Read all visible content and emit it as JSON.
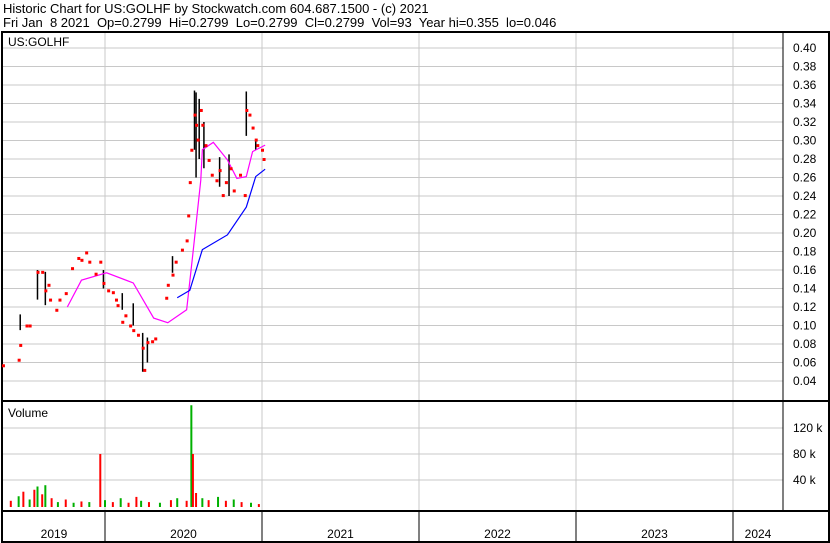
{
  "header": {
    "title": "Historic Chart for US:GOLHF by Stockwatch.com 604.687.1500 - (c) 2021",
    "quote": "Fri Jan  8 2021  Op=0.2799  Hi=0.2799  Lo=0.2799  Cl=0.2799  Vol=93  Year hi=0.355  lo=0.046"
  },
  "chart_data": {
    "type": "line",
    "title": "US:GOLHF",
    "price_ticks": [
      "0.40",
      "0.38",
      "0.36",
      "0.34",
      "0.32",
      "0.30",
      "0.28",
      "0.26",
      "0.24",
      "0.22",
      "0.20",
      "0.18",
      "0.16",
      "0.14",
      "0.12",
      "0.10",
      "0.08",
      "0.06",
      "0.04"
    ],
    "ylim": [
      0.028,
      0.41
    ],
    "year_labels": [
      "2019",
      "2020",
      "2021",
      "2022",
      "2023",
      "2024"
    ],
    "x_range_years": [
      2019.33,
      2024.5
    ],
    "closes": [
      [
        2019.35,
        0.057
      ],
      [
        2019.45,
        0.063
      ],
      [
        2019.46,
        0.079
      ],
      [
        2019.5,
        0.1
      ],
      [
        2019.52,
        0.1
      ],
      [
        2019.57,
        0.158
      ],
      [
        2019.6,
        0.158
      ],
      [
        2019.62,
        0.138
      ],
      [
        2019.64,
        0.144
      ],
      [
        2019.65,
        0.128
      ],
      [
        2019.69,
        0.117
      ],
      [
        2019.71,
        0.128
      ],
      [
        2019.75,
        0.135
      ],
      [
        2019.79,
        0.162
      ],
      [
        2019.83,
        0.173
      ],
      [
        2019.85,
        0.171
      ],
      [
        2019.88,
        0.179
      ],
      [
        2019.9,
        0.169
      ],
      [
        2019.94,
        0.156
      ],
      [
        2019.97,
        0.169
      ],
      [
        2019.99,
        0.146
      ],
      [
        2020.02,
        0.138
      ],
      [
        2020.05,
        0.136
      ],
      [
        2020.07,
        0.128
      ],
      [
        2020.08,
        0.122
      ],
      [
        2020.11,
        0.104
      ],
      [
        2020.13,
        0.111
      ],
      [
        2020.16,
        0.1
      ],
      [
        2020.18,
        0.095
      ],
      [
        2020.21,
        0.09
      ],
      [
        2020.24,
        0.076
      ],
      [
        2020.25,
        0.052
      ],
      [
        2020.27,
        0.082
      ],
      [
        2020.3,
        0.083
      ],
      [
        2020.32,
        0.086
      ],
      [
        2020.39,
        0.13
      ],
      [
        2020.4,
        0.144
      ],
      [
        2020.43,
        0.155
      ],
      [
        2020.45,
        0.169
      ],
      [
        2020.49,
        0.182
      ],
      [
        2020.52,
        0.192
      ],
      [
        2020.53,
        0.219
      ],
      [
        2020.54,
        0.255
      ],
      [
        2020.55,
        0.29
      ],
      [
        2020.57,
        0.328
      ],
      [
        2020.58,
        0.317
      ],
      [
        2020.59,
        0.301
      ],
      [
        2020.61,
        0.333
      ],
      [
        2020.62,
        0.317
      ],
      [
        2020.64,
        0.295
      ],
      [
        2020.66,
        0.279
      ],
      [
        2020.68,
        0.263
      ],
      [
        2020.71,
        0.257
      ],
      [
        2020.73,
        0.268
      ],
      [
        2020.75,
        0.241
      ],
      [
        2020.77,
        0.255
      ],
      [
        2020.8,
        0.27
      ],
      [
        2020.82,
        0.246
      ],
      [
        2020.86,
        0.263
      ],
      [
        2020.89,
        0.241
      ],
      [
        2020.9,
        0.333
      ],
      [
        2020.92,
        0.328
      ],
      [
        2020.94,
        0.314
      ],
      [
        2020.96,
        0.301
      ],
      [
        2020.97,
        0.295
      ],
      [
        2021.0,
        0.29
      ],
      [
        2021.01,
        0.28
      ]
    ],
    "hilo_bars": [
      [
        2019.46,
        0.112,
        0.095
      ],
      [
        2019.57,
        0.16,
        0.128
      ],
      [
        2019.62,
        0.158,
        0.122
      ],
      [
        2019.99,
        0.16,
        0.14
      ],
      [
        2020.11,
        0.135,
        0.117
      ],
      [
        2020.18,
        0.124,
        0.1
      ],
      [
        2020.24,
        0.092,
        0.05
      ],
      [
        2020.27,
        0.087,
        0.06
      ],
      [
        2020.43,
        0.175,
        0.157
      ],
      [
        2020.57,
        0.354,
        0.29
      ],
      [
        2020.58,
        0.352,
        0.26
      ],
      [
        2020.6,
        0.345,
        0.28
      ],
      [
        2020.63,
        0.32,
        0.27
      ],
      [
        2020.73,
        0.282,
        0.25
      ],
      [
        2020.79,
        0.285,
        0.24
      ],
      [
        2020.9,
        0.353,
        0.305
      ],
      [
        2020.96,
        0.3,
        0.29
      ]
    ],
    "series": [
      {
        "name": "short moving average",
        "color": "#ff00ff",
        "points": [
          [
            2019.76,
            0.12
          ],
          [
            2019.85,
            0.149
          ],
          [
            2020.01,
            0.157
          ],
          [
            2020.18,
            0.146
          ],
          [
            2020.31,
            0.108
          ],
          [
            2020.4,
            0.103
          ],
          [
            2020.52,
            0.117
          ],
          [
            2020.56,
            0.178
          ],
          [
            2020.61,
            0.257
          ],
          [
            2020.62,
            0.29
          ],
          [
            2020.69,
            0.298
          ],
          [
            2020.78,
            0.279
          ],
          [
            2020.84,
            0.259
          ],
          [
            2020.9,
            0.261
          ],
          [
            2020.94,
            0.288
          ],
          [
            2021.02,
            0.295
          ]
        ]
      },
      {
        "name": "long moving average",
        "color": "#0000ff",
        "points": [
          [
            2020.46,
            0.13
          ],
          [
            2020.54,
            0.138
          ],
          [
            2020.62,
            0.182
          ],
          [
            2020.78,
            0.198
          ],
          [
            2020.9,
            0.228
          ],
          [
            2020.96,
            0.261
          ],
          [
            2021.02,
            0.269
          ]
        ]
      }
    ],
    "volume": {
      "label": "Volume",
      "ticks": [
        "120 k",
        "80 k",
        "40 k"
      ],
      "tick_values": [
        120000,
        80000,
        40000
      ],
      "ylim": [
        0,
        160000
      ],
      "bars": [
        [
          2019.4,
          8000,
          "r"
        ],
        [
          2019.45,
          15000,
          "g"
        ],
        [
          2019.48,
          22000,
          "r"
        ],
        [
          2019.52,
          10000,
          "g"
        ],
        [
          2019.55,
          25000,
          "r"
        ],
        [
          2019.57,
          30000,
          "g"
        ],
        [
          2019.6,
          18000,
          "r"
        ],
        [
          2019.62,
          32000,
          "g"
        ],
        [
          2019.66,
          12000,
          "r"
        ],
        [
          2019.7,
          6000,
          "g"
        ],
        [
          2019.75,
          10000,
          "r"
        ],
        [
          2019.8,
          5000,
          "g"
        ],
        [
          2019.85,
          7000,
          "r"
        ],
        [
          2019.9,
          6000,
          "g"
        ],
        [
          2019.97,
          80000,
          "r"
        ],
        [
          2020.0,
          9000,
          "g"
        ],
        [
          2020.05,
          6000,
          "r"
        ],
        [
          2020.1,
          12000,
          "g"
        ],
        [
          2020.15,
          5000,
          "r"
        ],
        [
          2020.2,
          14000,
          "r"
        ],
        [
          2020.23,
          8000,
          "g"
        ],
        [
          2020.28,
          6000,
          "r"
        ],
        [
          2020.35,
          5000,
          "g"
        ],
        [
          2020.42,
          9000,
          "r"
        ],
        [
          2020.46,
          12000,
          "g"
        ],
        [
          2020.52,
          8000,
          "r"
        ],
        [
          2020.55,
          155000,
          "g"
        ],
        [
          2020.56,
          80000,
          "r"
        ],
        [
          2020.58,
          20000,
          "r"
        ],
        [
          2020.62,
          12000,
          "g"
        ],
        [
          2020.66,
          9000,
          "r"
        ],
        [
          2020.72,
          14000,
          "g"
        ],
        [
          2020.77,
          8000,
          "r"
        ],
        [
          2020.82,
          10000,
          "g"
        ],
        [
          2020.87,
          6000,
          "r"
        ],
        [
          2020.93,
          5000,
          "g"
        ],
        [
          2020.98,
          3000,
          "r"
        ]
      ]
    }
  }
}
